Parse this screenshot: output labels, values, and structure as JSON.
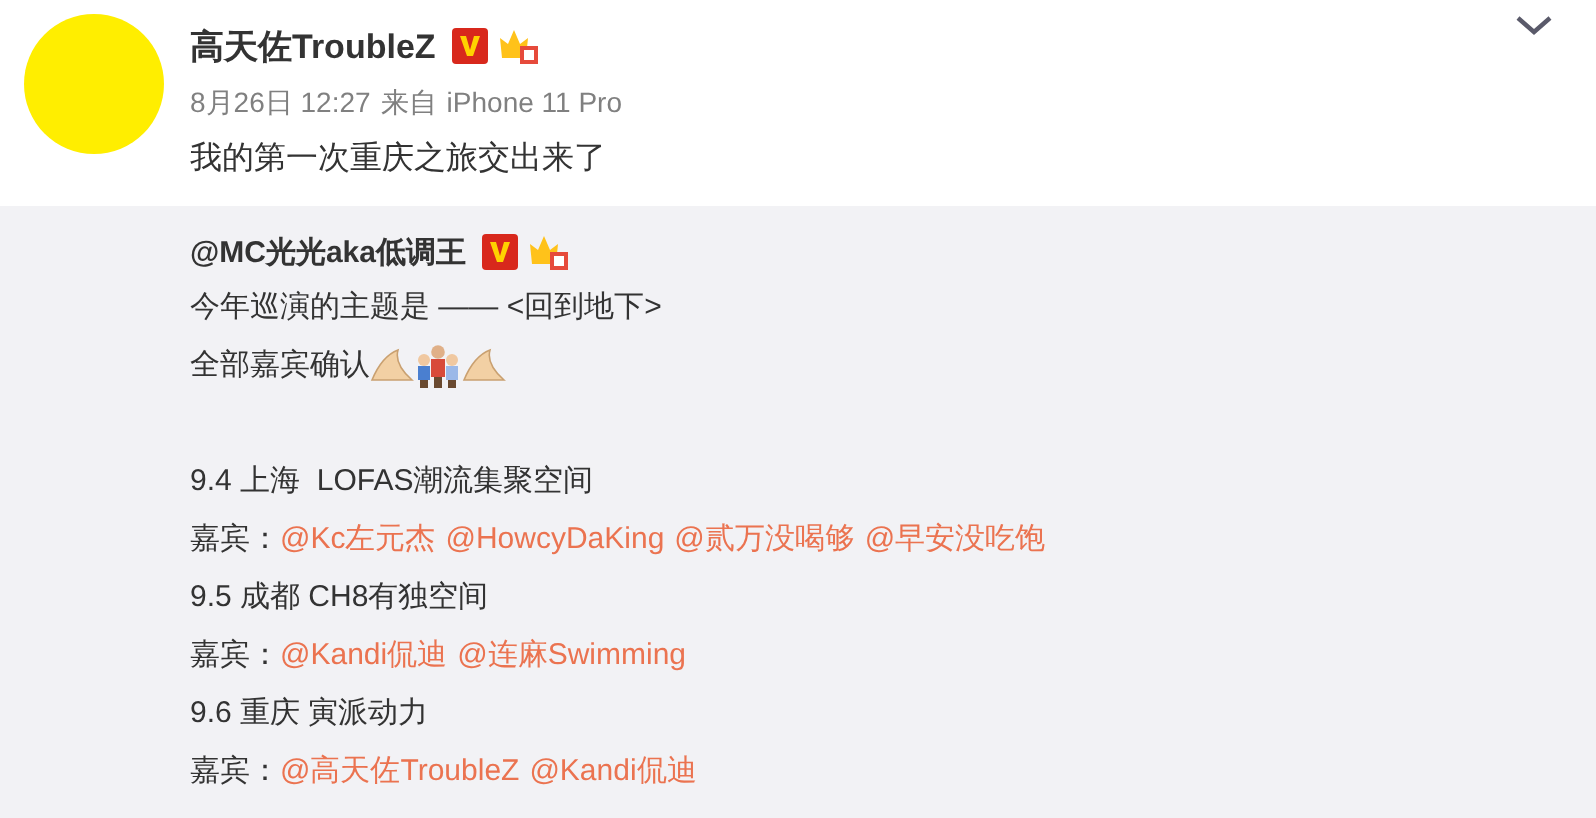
{
  "post": {
    "author": "高天佐TroubleZ",
    "time": "8月26日 12:27",
    "source_prefix": "来自",
    "source": "iPhone 11 Pro",
    "text": "我的第一次重庆之旅交出来了"
  },
  "repost": {
    "author": "@MC光光aka低调王",
    "lines": [
      {
        "kind": "text",
        "text": "今年巡演的主题是 —— <回到地下>"
      },
      {
        "kind": "emoji",
        "text": "全部嘉宾确认"
      },
      {
        "kind": "blank"
      },
      {
        "kind": "text",
        "text": "9.4 上海  LOFAS潮流集聚空间"
      },
      {
        "kind": "guests",
        "text": "嘉宾：",
        "mentions": [
          "@Kc左元杰",
          "@HowcyDaKing",
          "@贰万没喝够",
          "@早安没吃饱"
        ]
      },
      {
        "kind": "text",
        "text": "9.5 成都 CH8有独空间"
      },
      {
        "kind": "guests",
        "text": "嘉宾：",
        "mentions": [
          "@Kandi侃迪",
          "@连麻Swimming"
        ]
      },
      {
        "kind": "text",
        "text": "9.6 重庆 寅派动力"
      },
      {
        "kind": "guests",
        "text": "嘉宾：",
        "mentions": [
          "@高天佐TroubleZ",
          "@Kandi侃迪"
        ]
      }
    ]
  }
}
